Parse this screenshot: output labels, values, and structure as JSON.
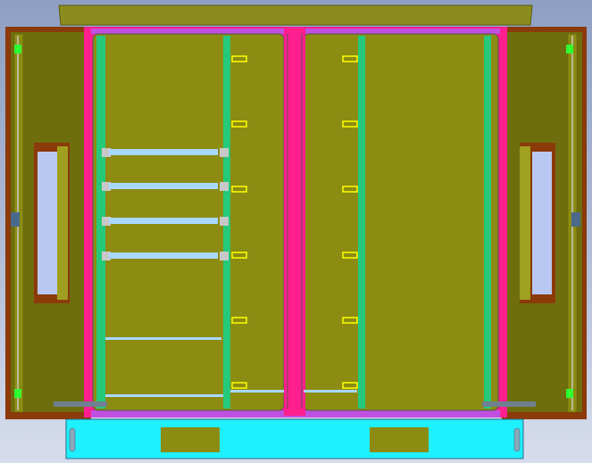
{
  "colors": {
    "background_top": "#8e9fc3",
    "background_bottom": "#d7dded",
    "roof": "#8c8c1e",
    "cabinet_panel": "#8c8c12",
    "door_panel": "#6e6e0e",
    "frame_pink": "#ff1f8f",
    "frame_purple": "#c050e0",
    "rail_green": "#25c97a",
    "shelf_blue": "#a8d8ff",
    "base_cyan": "#1ff0ff",
    "base_pad": "#8c8c12",
    "hinge_green": "#30ff30",
    "label_yellow": "#ffff00",
    "door_edge_brown": "#8b3a0a",
    "handle_slot": "#b8c8f0"
  },
  "components": {
    "shelves_left_count": 4,
    "label_tags_per_column": 6
  }
}
